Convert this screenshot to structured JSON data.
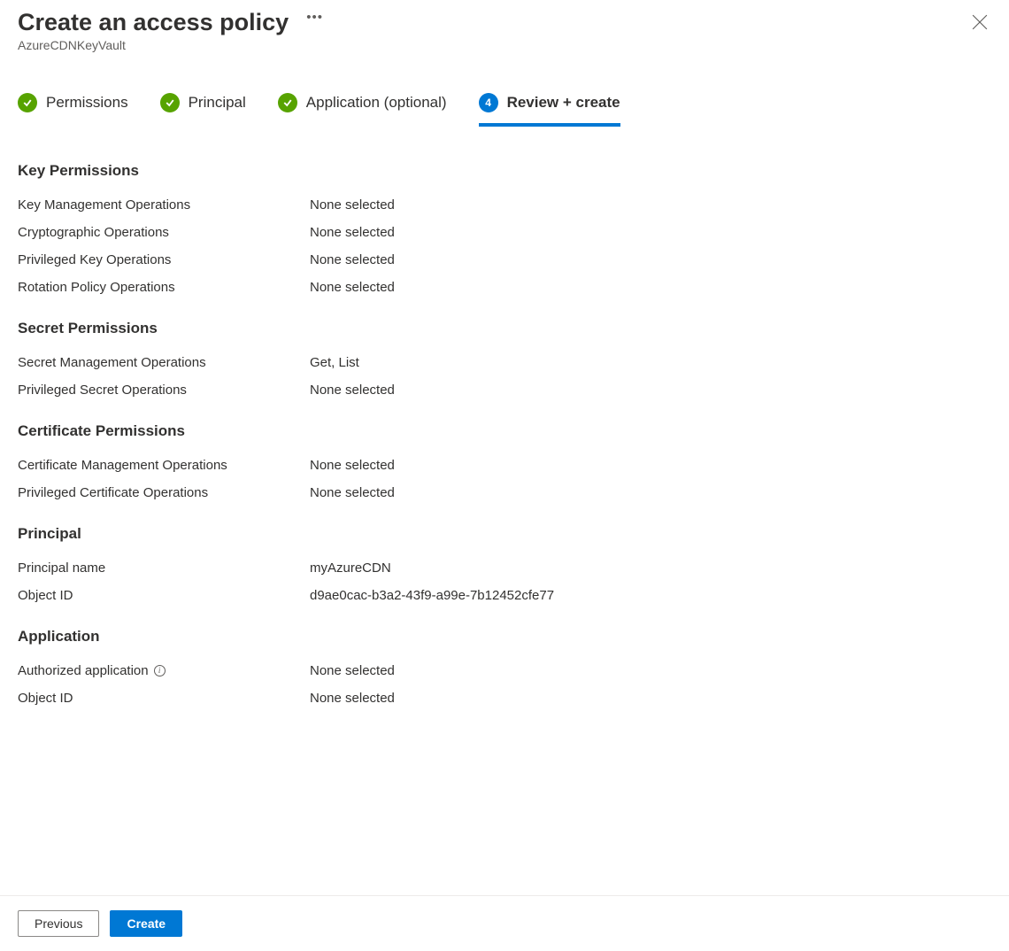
{
  "header": {
    "title": "Create an access policy",
    "subtitle": "AzureCDNKeyVault"
  },
  "steps": [
    {
      "label": "Permissions",
      "state": "done"
    },
    {
      "label": "Principal",
      "state": "done"
    },
    {
      "label": "Application (optional)",
      "state": "done"
    },
    {
      "label": "Review + create",
      "state": "current",
      "number": "4"
    }
  ],
  "sections": {
    "keyPermissions": {
      "title": "Key Permissions",
      "rows": [
        {
          "label": "Key Management Operations",
          "value": "None selected"
        },
        {
          "label": "Cryptographic Operations",
          "value": "None selected"
        },
        {
          "label": "Privileged Key Operations",
          "value": "None selected"
        },
        {
          "label": "Rotation Policy Operations",
          "value": "None selected"
        }
      ]
    },
    "secretPermissions": {
      "title": "Secret Permissions",
      "rows": [
        {
          "label": "Secret Management Operations",
          "value": "Get, List"
        },
        {
          "label": "Privileged Secret Operations",
          "value": "None selected"
        }
      ]
    },
    "certificatePermissions": {
      "title": "Certificate Permissions",
      "rows": [
        {
          "label": "Certificate Management Operations",
          "value": "None selected"
        },
        {
          "label": "Privileged Certificate Operations",
          "value": "None selected"
        }
      ]
    },
    "principal": {
      "title": "Principal",
      "rows": [
        {
          "label": "Principal name",
          "value": "myAzureCDN"
        },
        {
          "label": "Object ID",
          "value": "d9ae0cac-b3a2-43f9-a99e-7b12452cfe77"
        }
      ]
    },
    "application": {
      "title": "Application",
      "rows": [
        {
          "label": "Authorized application",
          "value": "None selected",
          "hasInfo": true
        },
        {
          "label": "Object ID",
          "value": "None selected"
        }
      ]
    }
  },
  "footer": {
    "previous": "Previous",
    "create": "Create"
  }
}
